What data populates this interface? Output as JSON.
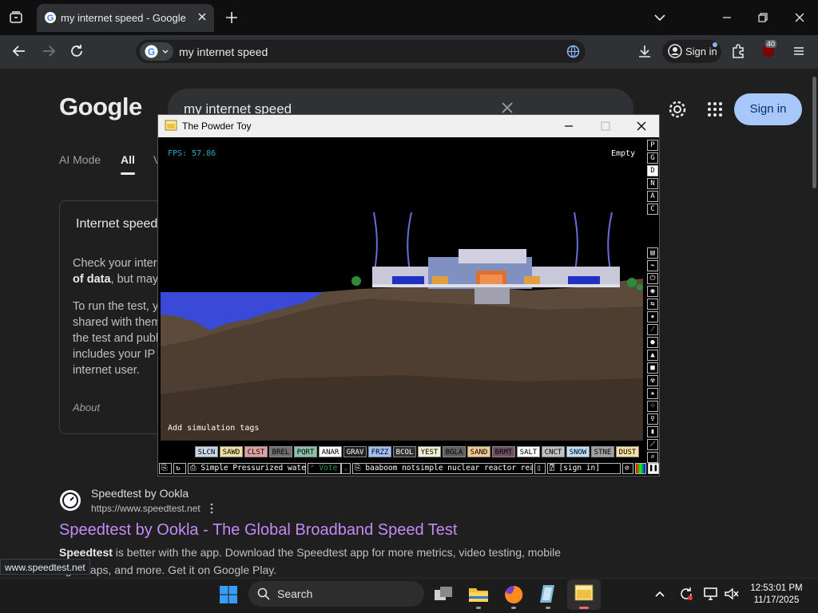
{
  "browser": {
    "tab_title": "my internet speed - Google Sea",
    "address": "my internet speed",
    "signin_label": "Sign in",
    "extension_badge": "40"
  },
  "google": {
    "logo": "Google",
    "query": "my internet speed",
    "signin_label": "Sign in",
    "tabs": [
      "AI Mode",
      "All",
      "V"
    ],
    "card": {
      "title": "Internet speed",
      "p1_line1": "Check your intern",
      "p1_line2_bold": "of data",
      "p1_line2_rest": ", but may",
      "p2_lines": [
        "To run the test, yo",
        "shared with them",
        "the test and publi",
        "includes your IP a",
        "internet user."
      ],
      "about": "About"
    },
    "result": {
      "site": "Speedtest by Ookla",
      "url": "https://www.speedtest.net",
      "title": "Speedtest by Ookla - The Global Broadband Speed Test",
      "desc_bold": "Speedtest",
      "desc_rest": " is better with the app. Download the Speedtest app for more metrics, video testing, mobile",
      "desc2": "age maps, and more. Get it on Google Play."
    },
    "status_url": "www.speedtest.net"
  },
  "powder_toy": {
    "title": "The Powder Toy",
    "fps": "FPS: 57.86",
    "hover": "Empty",
    "tags_hint": "Add simulation tags",
    "right_buttons": [
      "P",
      "G",
      "D",
      "N",
      "A",
      "C"
    ],
    "elements": [
      {
        "label": "SLCN",
        "bg": "#c8d8e8",
        "fg": "#000"
      },
      {
        "label": "SAWD",
        "bg": "#f0e0a0",
        "fg": "#000"
      },
      {
        "label": "CLST",
        "bg": "#e0a0a0",
        "fg": "#000"
      },
      {
        "label": "BREL",
        "bg": "#707070",
        "fg": "#000"
      },
      {
        "label": "PQRT",
        "bg": "#88c0a8",
        "fg": "#000"
      },
      {
        "label": "ANAR",
        "bg": "#ffffff",
        "fg": "#000"
      },
      {
        "label": "GRAV",
        "bg": "#202020",
        "fg": "#fff"
      },
      {
        "label": "FRZZ",
        "bg": "#a0c0ff",
        "fg": "#000"
      },
      {
        "label": "BCOL",
        "bg": "#303030",
        "fg": "#fff"
      },
      {
        "label": "YEST",
        "bg": "#f0f0d0",
        "fg": "#000"
      },
      {
        "label": "BGLA",
        "bg": "#606060",
        "fg": "#000"
      },
      {
        "label": "SAND",
        "bg": "#f0c890",
        "fg": "#000"
      },
      {
        "label": "BRMT",
        "bg": "#705060",
        "fg": "#000"
      },
      {
        "label": "SALT",
        "bg": "#ffffff",
        "fg": "#000"
      },
      {
        "label": "CNCT",
        "bg": "#c0c0c0",
        "fg": "#000"
      },
      {
        "label": "SNOW",
        "bg": "#c0e0ff",
        "fg": "#000"
      },
      {
        "label": "STNE",
        "bg": "#a0a0a0",
        "fg": "#000"
      },
      {
        "label": "DUST",
        "bg": "#ffe0a0",
        "fg": "#000"
      }
    ],
    "save_name": "Simple Pressurized wate...",
    "vote_label": "Vote",
    "description": "baaboom notsimple nuclear reactor realis...",
    "signin_label": "[sign in]"
  },
  "taskbar": {
    "search_label": "Search",
    "time": "12:53:01 PM",
    "date": "11/17/2025"
  }
}
